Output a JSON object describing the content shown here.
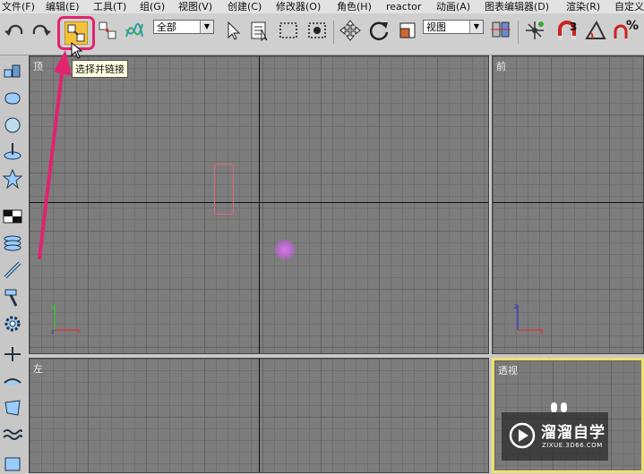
{
  "menu": {
    "items": [
      "文件(F)",
      "编辑(E)",
      "工具(T)",
      "组(G)",
      "视图(V)",
      "创建(C)",
      "修改器(O)",
      "角色(H)",
      "reactor",
      "动画(A)",
      "图表编辑器(D)",
      "渲染(R)",
      "自定义"
    ]
  },
  "toolbar": {
    "selection_filter": "全部",
    "ref_coord": "视图",
    "snap_angle_label": "3",
    "percent_snap_label": "%",
    "tooltip": "选择并链接"
  },
  "viewports": {
    "top_label": "顶",
    "front_label": "前",
    "left_label": "左",
    "perspective_label": "透视"
  },
  "watermark": {
    "title": "溜溜自学",
    "url": "ZIXUE.3D66.COM"
  },
  "colors": {
    "highlight": "#e0246e",
    "active_viewport": "#f0e16a",
    "object": "#b469c9"
  }
}
